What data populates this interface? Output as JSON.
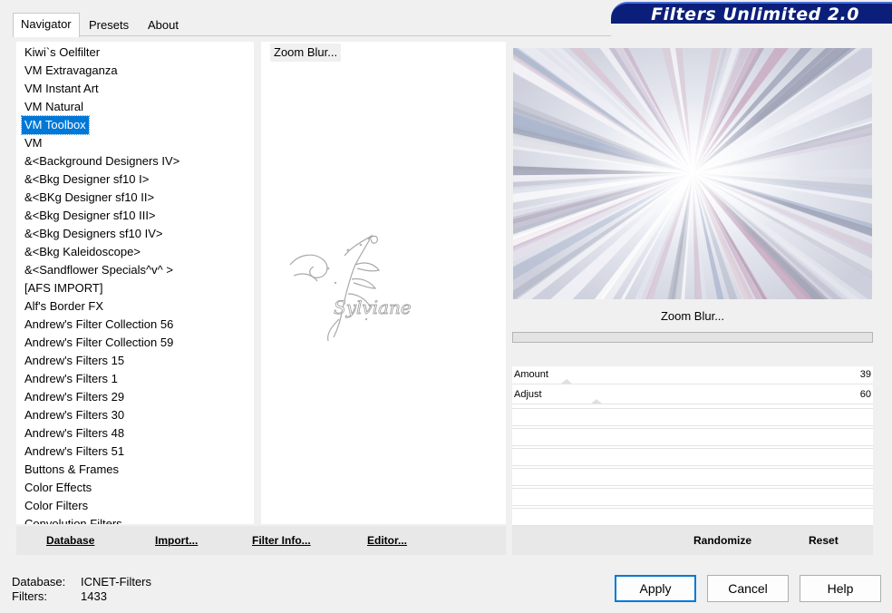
{
  "app": {
    "banner_title": "Filters Unlimited 2.0"
  },
  "tabs": [
    {
      "label": "Navigator",
      "active": true
    },
    {
      "label": "Presets",
      "active": false
    },
    {
      "label": "About",
      "active": false
    }
  ],
  "categories": [
    {
      "label": " Kiwi`s Oelfilter",
      "selected": false
    },
    {
      "label": " VM Extravaganza",
      "selected": false
    },
    {
      "label": " VM Instant Art",
      "selected": false
    },
    {
      "label": " VM Natural",
      "selected": false
    },
    {
      "label": " VM Toolbox",
      "selected": true
    },
    {
      "label": " VM",
      "selected": false
    },
    {
      "label": "&<Background Designers IV>",
      "selected": false
    },
    {
      "label": "&<Bkg Designer sf10 I>",
      "selected": false
    },
    {
      "label": "&<BKg Designer sf10 II>",
      "selected": false
    },
    {
      "label": "&<Bkg Designer sf10 III>",
      "selected": false
    },
    {
      "label": "&<Bkg Designers sf10 IV>",
      "selected": false
    },
    {
      "label": "&<Bkg Kaleidoscope>",
      "selected": false
    },
    {
      "label": "&<Sandflower Specials^v^ >",
      "selected": false
    },
    {
      "label": "[AFS IMPORT]",
      "selected": false
    },
    {
      "label": "Alf's Border FX",
      "selected": false
    },
    {
      "label": "Andrew's Filter Collection 56",
      "selected": false
    },
    {
      "label": "Andrew's Filter Collection 59",
      "selected": false
    },
    {
      "label": "Andrew's Filters 15",
      "selected": false
    },
    {
      "label": "Andrew's Filters 1",
      "selected": false
    },
    {
      "label": "Andrew's Filters 29",
      "selected": false
    },
    {
      "label": "Andrew's Filters 30",
      "selected": false
    },
    {
      "label": "Andrew's Filters 48",
      "selected": false
    },
    {
      "label": "Andrew's Filters 51",
      "selected": false
    },
    {
      "label": "Buttons & Frames",
      "selected": false
    },
    {
      "label": "Color Effects",
      "selected": false
    },
    {
      "label": "Color Filters",
      "selected": false
    },
    {
      "label": "Convolution Filters",
      "selected": false
    }
  ],
  "filters": [
    {
      "label": "Zoom Blur..."
    }
  ],
  "watermark_text": "Sylviane",
  "preview": {
    "filter_name": "Zoom Blur..."
  },
  "params": [
    {
      "label": "Amount",
      "value": "39",
      "level": 39
    },
    {
      "label": "Adjust",
      "value": "60",
      "level": 60
    }
  ],
  "left_buttons": [
    {
      "label": "Database"
    },
    {
      "label": "Import..."
    },
    {
      "label": "Filter Info..."
    },
    {
      "label": "Editor..."
    }
  ],
  "right_buttons": [
    {
      "label": "Randomize"
    },
    {
      "label": "Reset"
    }
  ],
  "status": {
    "database_label": "Database:",
    "database_value": "ICNET-Filters",
    "filters_label": "Filters:",
    "filters_value": "1433"
  },
  "dialog_buttons": {
    "apply": "Apply",
    "cancel": "Cancel",
    "help": "Help"
  }
}
